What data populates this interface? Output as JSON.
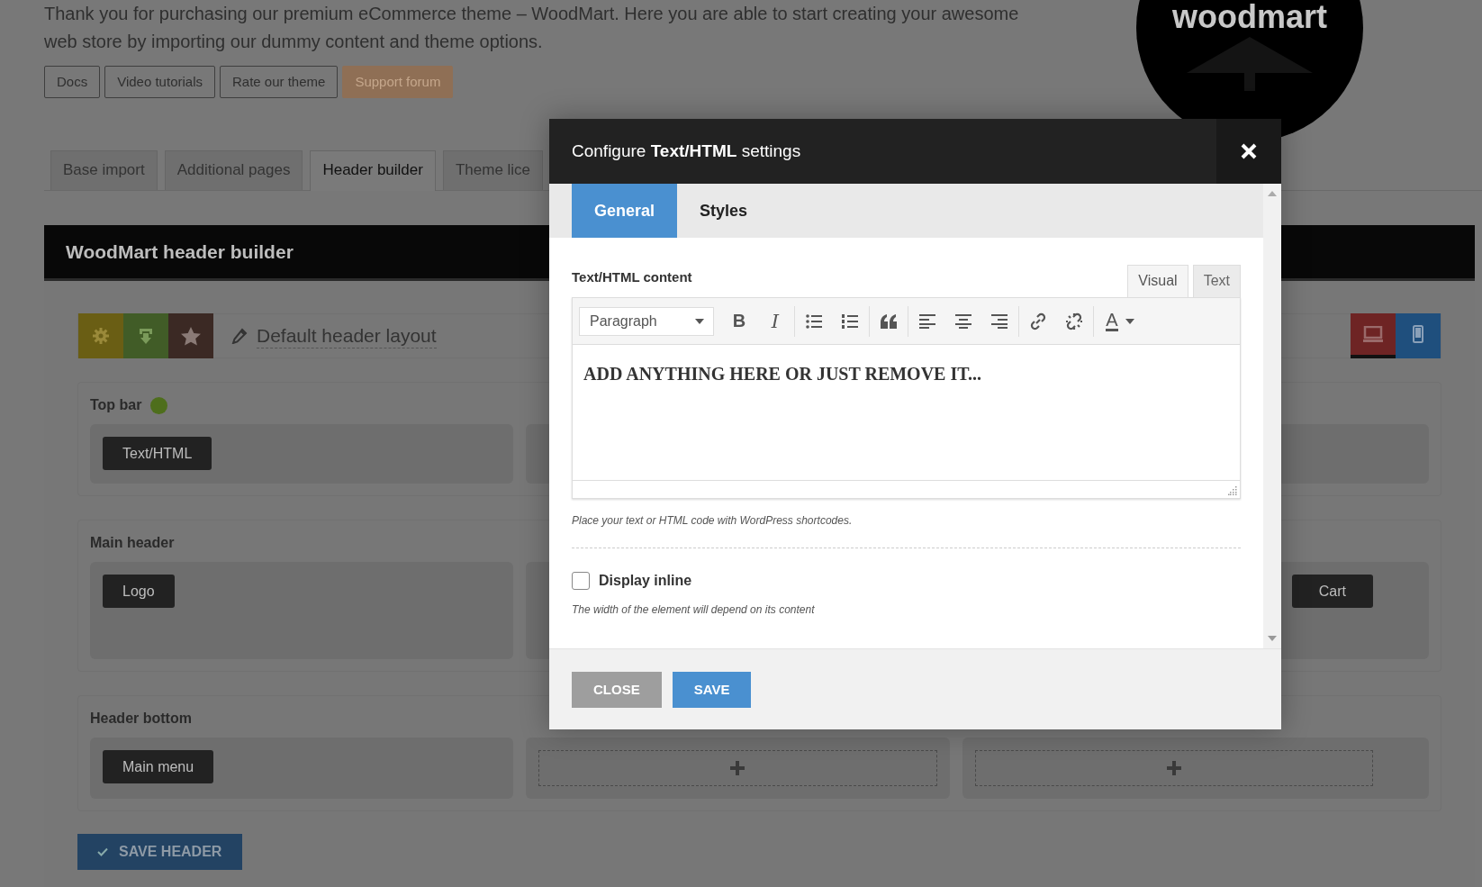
{
  "intro": {
    "text": "Thank you for purchasing our premium eCommerce theme – WoodMart. Here you are able to start creating your awesome web store by importing our dummy content and theme options.",
    "links": [
      {
        "label": "Docs",
        "kind": "outline"
      },
      {
        "label": "Video tutorials",
        "kind": "outline"
      },
      {
        "label": "Rate our theme",
        "kind": "outline"
      },
      {
        "label": "Support forum",
        "kind": "filled"
      }
    ],
    "logo_text": "woodmart"
  },
  "tabs": [
    {
      "label": "Base import",
      "selected": false
    },
    {
      "label": "Additional pages",
      "selected": false
    },
    {
      "label": "Header builder",
      "selected": true
    },
    {
      "label": "Theme lice",
      "selected": false
    }
  ],
  "builder": {
    "title": "WoodMart header builder",
    "layout_name": "Default header layout",
    "devices": [
      {
        "kind": "desktop",
        "selected": true
      },
      {
        "kind": "mobile",
        "selected": false
      }
    ],
    "rows": [
      {
        "title": "Top bar",
        "status_dot": true,
        "columns": [
          {
            "elements": [
              "Text/HTML"
            ]
          },
          {},
          {}
        ]
      },
      {
        "title": "Main header",
        "columns": [
          {
            "elements": [
              "Logo"
            ]
          },
          {},
          {
            "elements": [
              "Cart"
            ]
          }
        ]
      },
      {
        "title": "Header bottom",
        "columns": [
          {
            "elements": [
              "Main menu"
            ]
          },
          {
            "add_slot": true
          },
          {
            "add_slot": true
          }
        ]
      }
    ],
    "save_label": "SAVE HEADER"
  },
  "modal": {
    "title": "Configure **Text/HTML** settings",
    "tabs": [
      {
        "label": "General",
        "selected": true
      },
      {
        "label": "Styles",
        "selected": false
      }
    ],
    "field_label": "Text/HTML content",
    "editor_tabs": [
      {
        "label": "Visual",
        "selected": true
      },
      {
        "label": "Text",
        "selected": false
      }
    ],
    "format_select": "Paragraph",
    "toolbar": [
      {
        "kind": "bold",
        "label": "B"
      },
      {
        "kind": "italic",
        "label": "I"
      },
      {
        "kind": "sep"
      },
      {
        "kind": "bullets"
      },
      {
        "kind": "numbers"
      },
      {
        "kind": "sep"
      },
      {
        "kind": "quote"
      },
      {
        "kind": "sep"
      },
      {
        "kind": "align-left"
      },
      {
        "kind": "align-center"
      },
      {
        "kind": "align-right"
      },
      {
        "kind": "sep"
      },
      {
        "kind": "link"
      },
      {
        "kind": "unlink"
      },
      {
        "kind": "sep"
      },
      {
        "kind": "text-color",
        "label": "A"
      }
    ],
    "content": "ADD ANYTHING HERE OR JUST REMOVE IT...",
    "field_hint": "Place your text or HTML code with WordPress shortcodes.",
    "display_inline": {
      "label": "Display inline",
      "checked": false,
      "hint": "The width of the element will depend on its content"
    },
    "buttons": [
      {
        "label": "CLOSE",
        "kind": "secondary"
      },
      {
        "label": "SAVE",
        "kind": "primary"
      }
    ]
  }
}
